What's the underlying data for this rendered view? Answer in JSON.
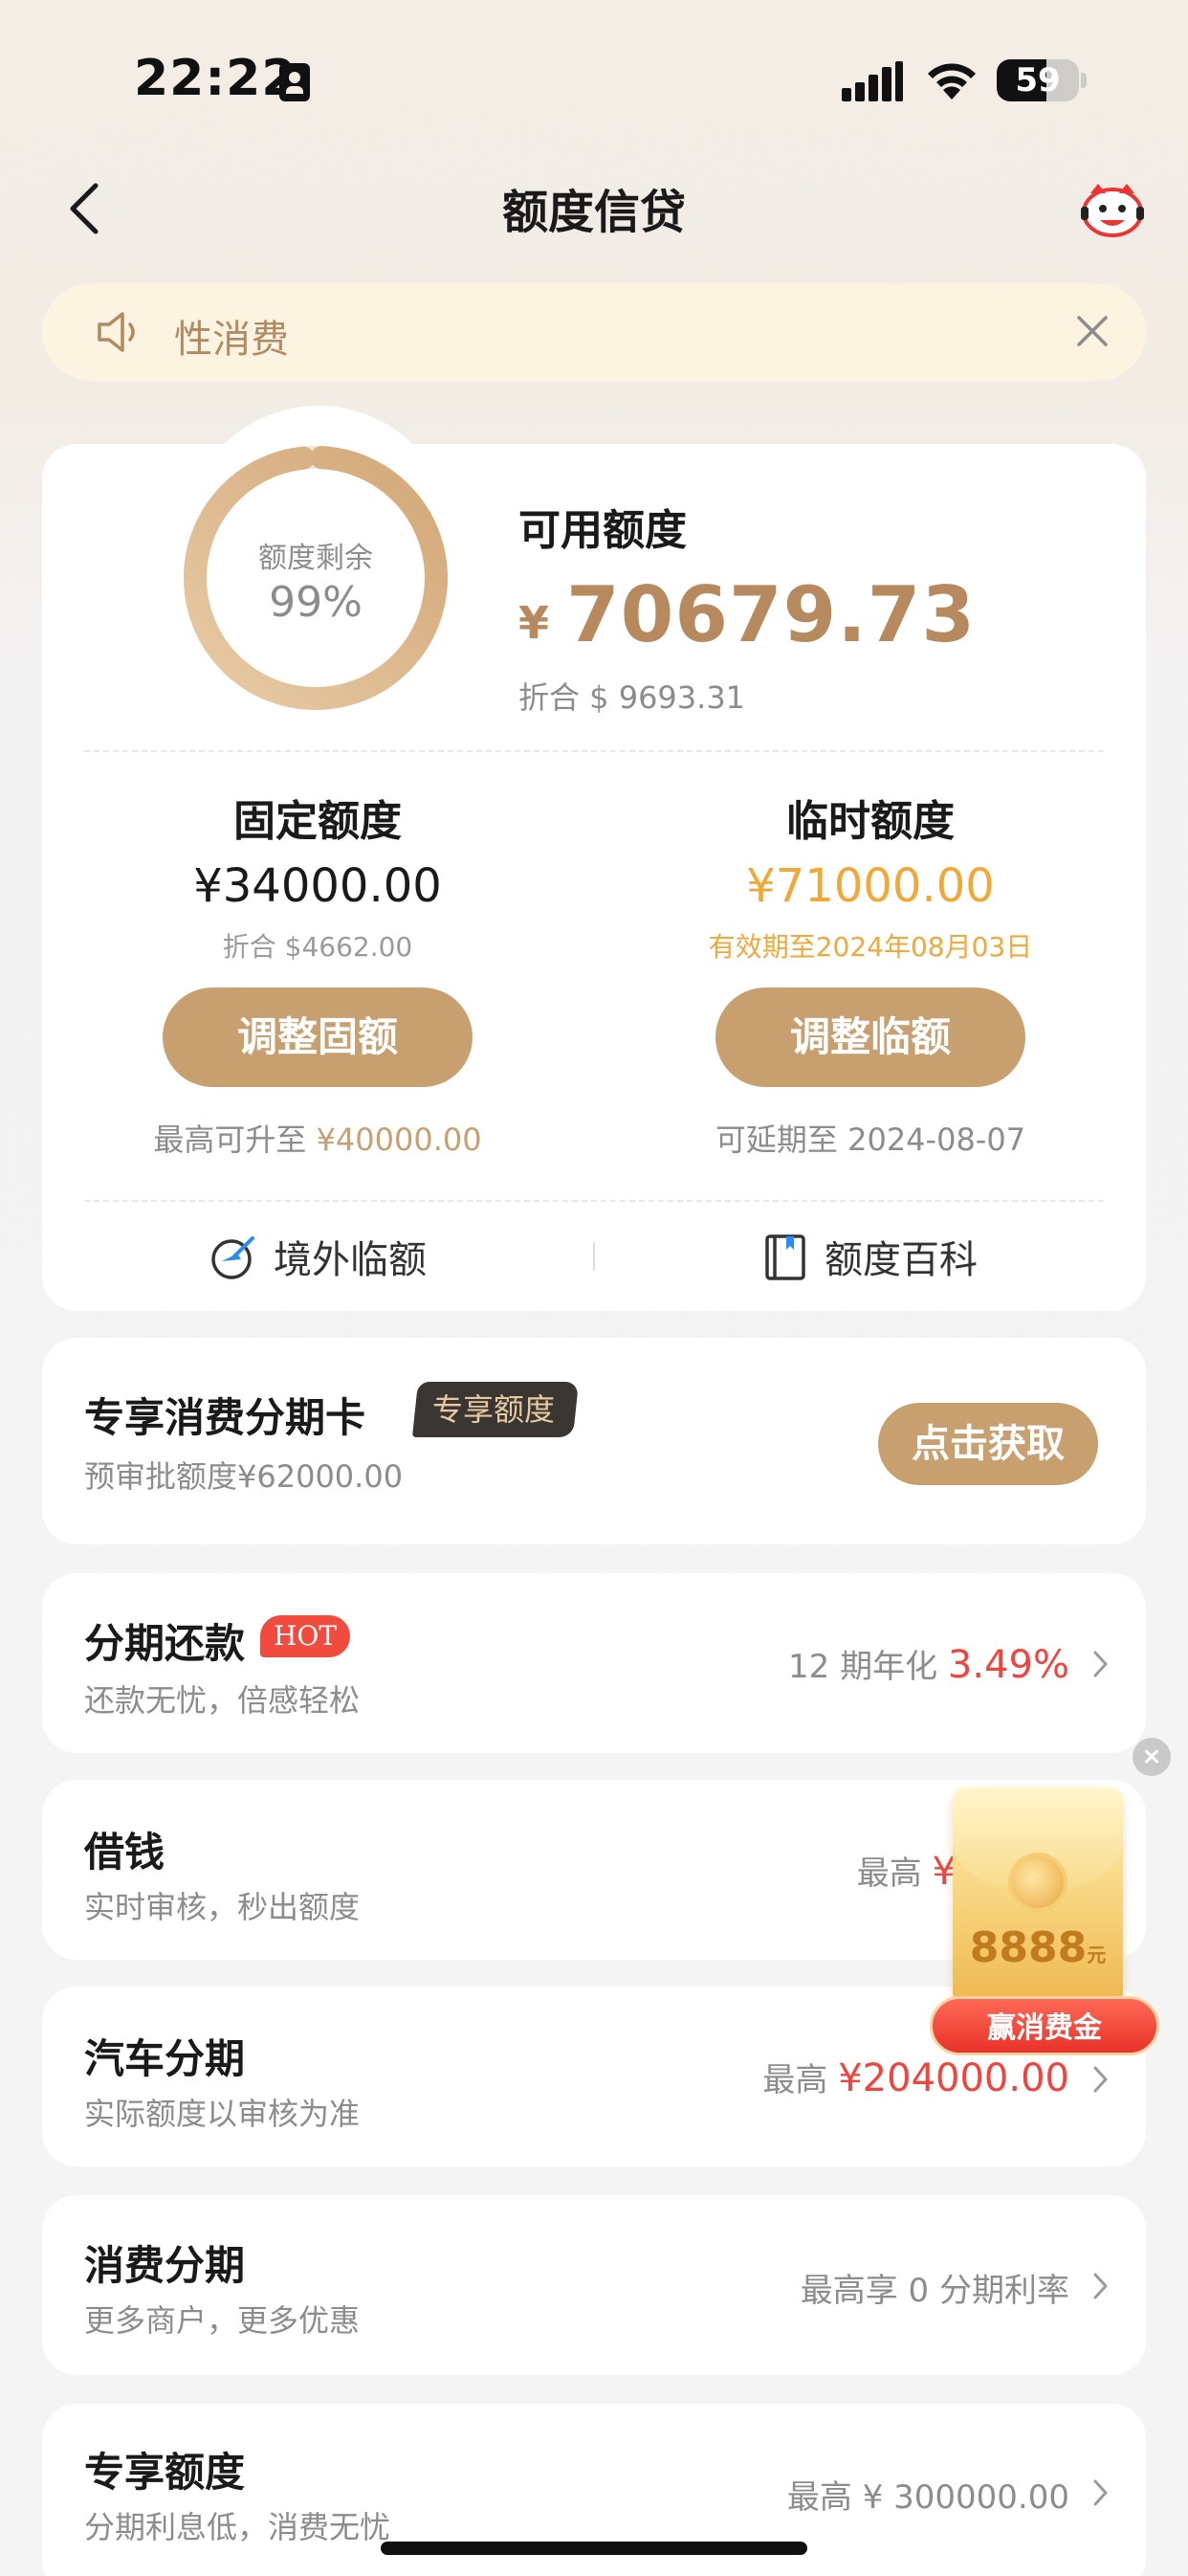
{
  "status_bar": {
    "time": "22:22",
    "battery": "59"
  },
  "nav": {
    "title": "额度信贷"
  },
  "notice": {
    "text": "性消费"
  },
  "credit": {
    "ring_label": "额度剩余",
    "ring_percent_text": "99%",
    "ring_fraction": 0.99,
    "available_label": "可用额度",
    "currency_symbol": "¥",
    "available_amount": "70679.73",
    "available_usd": "折合 $ 9693.31",
    "fixed": {
      "title": "固定额度",
      "amount": "¥34000.00",
      "sub": "折合 $4662.00",
      "button": "调整固额",
      "hint_prefix": "最高可升至",
      "hint_value": "¥40000.00"
    },
    "temp": {
      "title": "临时额度",
      "amount": "¥71000.00",
      "sub": "有效期至2024年08月03日",
      "button": "调整临额",
      "hint": "可延期至 2024-08-07"
    },
    "links": {
      "overseas": "境外临额",
      "wiki": "额度百科"
    }
  },
  "exclusive_card": {
    "title": "专享消费分期卡",
    "badge": "专享额度",
    "sub": "预审批额度¥62000.00",
    "button": "点击获取"
  },
  "products": [
    {
      "title": "分期还款",
      "badge": "HOT",
      "sub": "还款无忧，倍感轻松",
      "right_prefix": "12 期年化",
      "right_value": "3.49%"
    },
    {
      "title": "借钱",
      "sub": "实时审核，秒出额度",
      "right_prefix": "最高",
      "right_value": "¥"
    },
    {
      "title": "汽车分期",
      "sub": "实际额度以审核为准",
      "right_prefix": "最高",
      "right_value": "¥204000.00"
    },
    {
      "title": "消费分期",
      "sub": "更多商户，更多优惠",
      "right_prefix": "最高享 0 分期利率",
      "right_value": ""
    },
    {
      "title": "专享额度",
      "sub": "分期利息低，消费无忧",
      "right_prefix": "最高 ¥ 300000.00",
      "right_value": ""
    }
  ],
  "promo": {
    "amount": "8888",
    "unit": "元",
    "cta": "赢消费金"
  }
}
